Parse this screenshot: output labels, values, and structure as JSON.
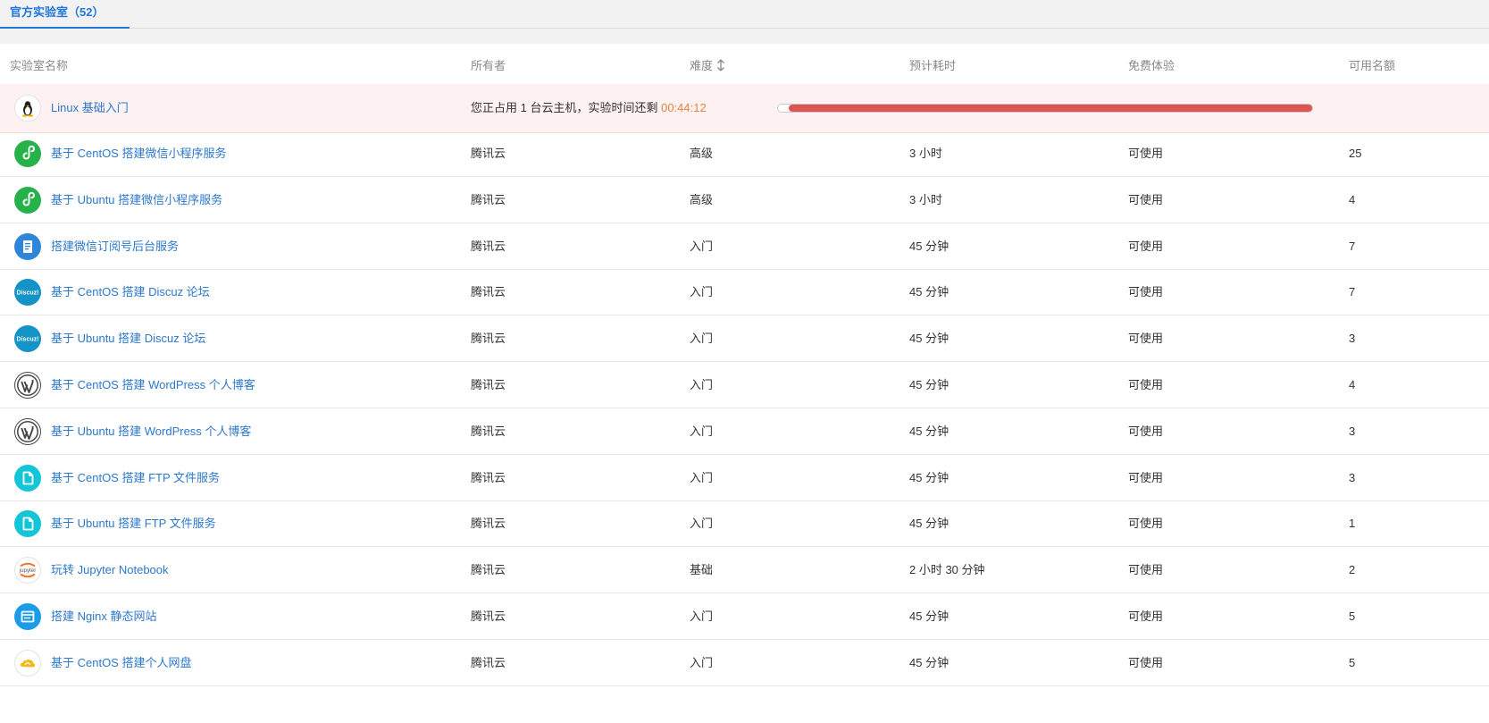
{
  "tabs": [
    {
      "label": "官方实验室（52）"
    }
  ],
  "columns": {
    "name": "实验室名称",
    "owner": "所有者",
    "difficulty": "难度",
    "duration": "预计耗时",
    "free": "免费体验",
    "quota": "可用名额"
  },
  "active_lab": {
    "name": "Linux 基础入门",
    "icon": "linux-penguin-icon",
    "status_text": "您正占用 1 台云主机，实验时间还剩",
    "time_left": "00:44:12",
    "progress_remaining": 0.98,
    "progress_color": "#dc5553"
  },
  "labs": [
    {
      "name": "基于 CentOS 搭建微信小程序服务",
      "icon": "wechat-miniprogram-icon",
      "owner": "腾讯云",
      "difficulty": "高级",
      "duration": "3 小时",
      "free": "可使用",
      "quota": "25"
    },
    {
      "name": "基于 Ubuntu 搭建微信小程序服务",
      "icon": "wechat-miniprogram-icon",
      "owner": "腾讯云",
      "difficulty": "高级",
      "duration": "3 小时",
      "free": "可使用",
      "quota": "4"
    },
    {
      "name": "搭建微信订阅号后台服务",
      "icon": "document-icon",
      "owner": "腾讯云",
      "difficulty": "入门",
      "duration": "45 分钟",
      "free": "可使用",
      "quota": "7"
    },
    {
      "name": "基于 CentOS 搭建 Discuz 论坛",
      "icon": "discuz-logo-icon",
      "owner": "腾讯云",
      "difficulty": "入门",
      "duration": "45 分钟",
      "free": "可使用",
      "quota": "7"
    },
    {
      "name": "基于 Ubuntu 搭建 Discuz 论坛",
      "icon": "discuz-logo-icon",
      "owner": "腾讯云",
      "difficulty": "入门",
      "duration": "45 分钟",
      "free": "可使用",
      "quota": "3"
    },
    {
      "name": "基于 CentOS 搭建 WordPress 个人博客",
      "icon": "wordpress-logo-icon",
      "owner": "腾讯云",
      "difficulty": "入门",
      "duration": "45 分钟",
      "free": "可使用",
      "quota": "4"
    },
    {
      "name": "基于 Ubuntu 搭建 WordPress 个人博客",
      "icon": "wordpress-logo-icon",
      "owner": "腾讯云",
      "difficulty": "入门",
      "duration": "45 分钟",
      "free": "可使用",
      "quota": "3"
    },
    {
      "name": "基于 CentOS 搭建 FTP 文件服务",
      "icon": "file-icon",
      "owner": "腾讯云",
      "difficulty": "入门",
      "duration": "45 分钟",
      "free": "可使用",
      "quota": "3"
    },
    {
      "name": "基于 Ubuntu 搭建 FTP 文件服务",
      "icon": "file-icon",
      "owner": "腾讯云",
      "difficulty": "入门",
      "duration": "45 分钟",
      "free": "可使用",
      "quota": "1"
    },
    {
      "name": "玩转 Jupyter Notebook",
      "icon": "jupyter-logo-icon",
      "owner": "腾讯云",
      "difficulty": "基础",
      "duration": "2 小时 30 分钟",
      "free": "可使用",
      "quota": "2"
    },
    {
      "name": "搭建 Nginx 静态网站",
      "icon": "browser-window-icon",
      "owner": "腾讯云",
      "difficulty": "入门",
      "duration": "45 分钟",
      "free": "可使用",
      "quota": "5"
    },
    {
      "name": "基于 CentOS 搭建个人网盘",
      "icon": "cloud-drive-icon",
      "owner": "腾讯云",
      "difficulty": "入门",
      "duration": "45 分钟",
      "free": "可使用",
      "quota": "5"
    }
  ],
  "colors": {
    "accent": "#2277da",
    "link": "#2d78c9",
    "timer": "#e5853a",
    "active_row_bg": "#fdf1f1",
    "miniprogram_green": "#27b14b",
    "discuz_blue": "#1493c6",
    "ftp_cyan": "#13c5d6",
    "nginx_blue": "#1a9ce8",
    "doc_blue": "#2f86d8",
    "jupyter_orange": "#f37626",
    "wordpress_gray": "#464646",
    "drive_yellow": "#f5b81c"
  }
}
